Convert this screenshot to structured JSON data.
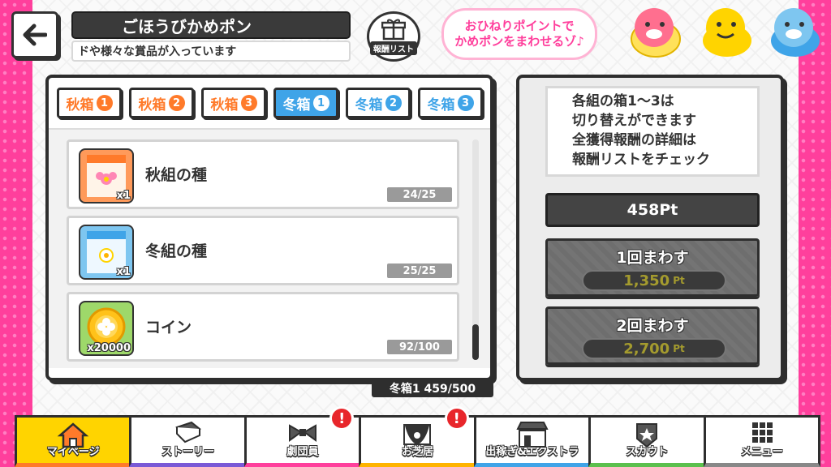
{
  "header": {
    "title": "ごほうびかめポン",
    "subtitle": "ドや様々な賞品が入っています",
    "reward_list_label": "報酬リスト",
    "speech_line1": "おひねりポイントで",
    "speech_line2": "かめポンをまわせるゾ♪"
  },
  "tabs": [
    {
      "label": "秋箱",
      "num": "1",
      "season": "autumn",
      "active": false
    },
    {
      "label": "秋箱",
      "num": "2",
      "season": "autumn",
      "active": false
    },
    {
      "label": "秋箱",
      "num": "3",
      "season": "autumn",
      "active": false
    },
    {
      "label": "冬箱",
      "num": "1",
      "season": "winter",
      "active": true
    },
    {
      "label": "冬箱",
      "num": "2",
      "season": "winter",
      "active": false
    },
    {
      "label": "冬箱",
      "num": "3",
      "season": "winter",
      "active": false
    }
  ],
  "items": [
    {
      "name": "秋組の種",
      "qty": "x1",
      "count": "24/25",
      "icon": "cosmos-seed-icon",
      "icon_label": "COSMOS"
    },
    {
      "name": "冬組の種",
      "qty": "x1",
      "count": "25/25",
      "icon": "narcissus-seed-icon",
      "icon_label": "NARCISSUS"
    },
    {
      "name": "コイン",
      "qty": "x20000",
      "count": "92/100",
      "icon": "coin-icon"
    }
  ],
  "box_total": "冬箱1 459/500",
  "info": {
    "line1": "各組の箱1～3は",
    "line2": "切り替えができます",
    "line3": "全獲得報酬の詳細は",
    "line4": "報酬リストをチェック"
  },
  "points": "458Pt",
  "spins": [
    {
      "label": "1回まわす",
      "cost": "1,350",
      "unit": "Pt"
    },
    {
      "label": "2回まわす",
      "cost": "2,700",
      "unit": "Pt"
    }
  ],
  "nav": [
    {
      "label": "マイページ",
      "icon": "home-icon",
      "alert": false
    },
    {
      "label": "ストーリー",
      "icon": "book-icon",
      "alert": false
    },
    {
      "label": "劇団員",
      "icon": "bowtie-icon",
      "alert": true
    },
    {
      "label": "お芝居",
      "icon": "theater-icon",
      "alert": true
    },
    {
      "label": "出稼ぎ&エクストラ",
      "icon": "shop-icon",
      "alert": false
    },
    {
      "label": "スカウト",
      "icon": "badge-icon",
      "alert": false
    },
    {
      "label": "メニュー",
      "icon": "grid-menu-icon",
      "alert": false
    }
  ],
  "alert_mark": "!",
  "colors": {
    "pink": "#ff3f9c",
    "autumn": "#ff7a2a",
    "winter": "#3fa4e8",
    "cost": "#a49b2e"
  }
}
